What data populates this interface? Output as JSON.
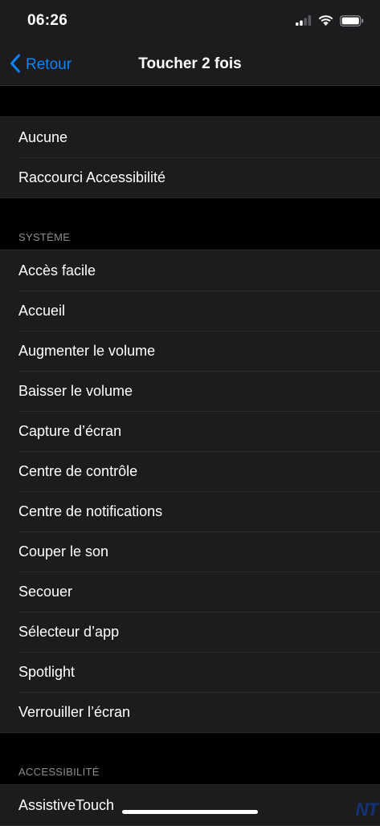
{
  "status_bar": {
    "time": "06:26",
    "signal_icon": "cellular-signal-icon",
    "wifi_icon": "wifi-icon",
    "battery_icon": "battery-icon"
  },
  "nav": {
    "back_label": "Retour",
    "title": "Toucher 2 fois",
    "accent_color": "#0a84ff"
  },
  "group_top": {
    "items": [
      "Aucune",
      "Raccourci Accessibilité"
    ]
  },
  "section_systeme": {
    "header": "SYSTÈME",
    "items": [
      "Accès facile",
      "Accueil",
      "Augmenter le volume",
      "Baisser le volume",
      "Capture d’écran",
      "Centre de contrôle",
      "Centre de notifications",
      "Couper le son",
      "Secouer",
      "Sélecteur d’app",
      "Spotlight",
      "Verrouiller l’écran"
    ]
  },
  "section_accessibilite": {
    "header": "ACCESSIBILITÉ",
    "items": [
      "AssistiveTouch"
    ]
  },
  "watermark": "NT"
}
